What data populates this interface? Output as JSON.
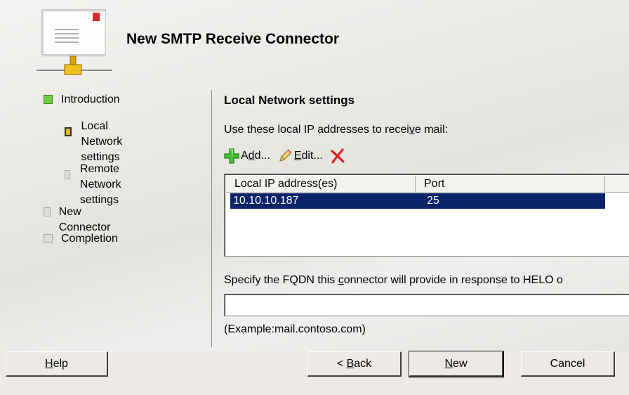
{
  "wizard": {
    "title": "New SMTP Receive Connector"
  },
  "nav": {
    "items": [
      {
        "label": "Introduction",
        "state": "completed"
      },
      {
        "label_line1": "Local Network",
        "label_line2": "settings",
        "state": "current"
      },
      {
        "label_line1": "Remote Network",
        "label_line2": "settings",
        "state": "pending"
      },
      {
        "label": "New Connector",
        "state": "pending"
      },
      {
        "label": "Completion",
        "state": "pending"
      }
    ]
  },
  "main": {
    "section_title": "Local Network settings",
    "instruction_pre": "Use these local IP addresses to recei",
    "instruction_u": "v",
    "instruction_post": "e mail:",
    "toolbar": {
      "add_pre": "A",
      "add_u": "d",
      "add_post": "d...",
      "edit_u": "E",
      "edit_post": "dit...",
      "add_icon": "green-plus-icon",
      "edit_icon": "pencil-icon",
      "remove_icon": "red-x-icon"
    },
    "table": {
      "columns": [
        "Local IP address(es)",
        "Port"
      ],
      "rows": [
        {
          "ip": "10.10.10.187",
          "port": "25",
          "selected": true
        }
      ]
    },
    "fqdn_label_pre": "Specify the FQDN this ",
    "fqdn_label_u": "c",
    "fqdn_label_post": "onnector will provide in response to HELO o",
    "fqdn_value": "",
    "example": "(Example:mail.contoso.com)"
  },
  "buttons": {
    "help_u": "H",
    "help_post": "elp",
    "back_pre": "< ",
    "back_u": "B",
    "back_post": "ack",
    "new_u": "N",
    "new_post": "ew",
    "cancel": "Cancel"
  },
  "colors": {
    "selection": "#0a246a",
    "completed": "#6fcf3f",
    "current": "#e8b800",
    "pending": "#dedcd8"
  }
}
